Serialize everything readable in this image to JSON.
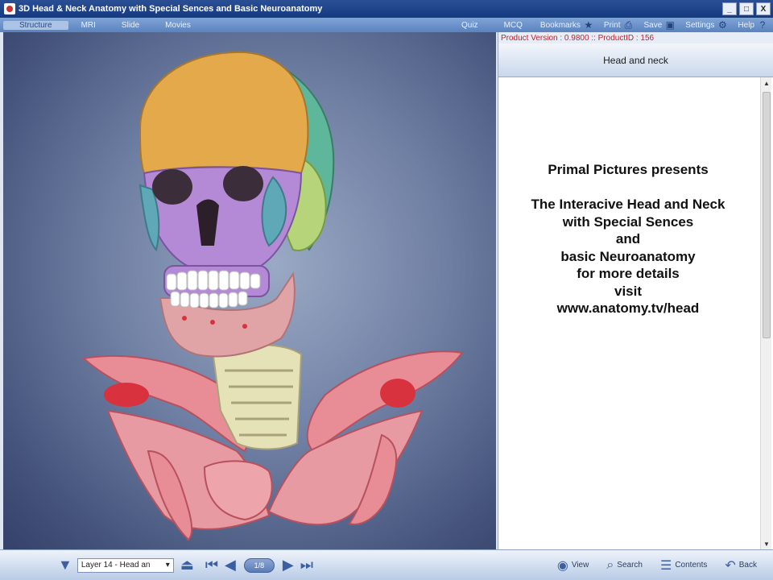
{
  "window": {
    "title": "3D Head & Neck Anatomy with Special Sences and Basic Neuroanatomy",
    "minimize": "_",
    "restore": "□",
    "close": "X"
  },
  "menu": {
    "items": [
      "Structure",
      "MRI",
      "Slide",
      "Movies",
      "Quiz",
      "MCQ"
    ],
    "tools": [
      {
        "label": "Bookmarks",
        "icon": "star-icon"
      },
      {
        "label": "Print",
        "icon": "printer-icon"
      },
      {
        "label": "Save",
        "icon": "disk-icon"
      },
      {
        "label": "Settings",
        "icon": "gear-icon"
      },
      {
        "label": "Help",
        "icon": "help-icon"
      }
    ]
  },
  "panel": {
    "version_text": "Product Version : 0.9800 :: ProductID : 156",
    "section_title": "Head and neck",
    "content_lines": [
      "Primal Pictures presents",
      "",
      "The Interacive Head and Neck",
      "with Special Sences",
      "and",
      "basic Neuroanatomy",
      "for more details",
      "visit",
      "www.anatomy.tv/head"
    ]
  },
  "bottom": {
    "layer_value": "Layer 14 - Head an",
    "counter": "1/8",
    "tools": [
      {
        "label": "View",
        "icon": "eye-icon"
      },
      {
        "label": "Search",
        "icon": "search-icon"
      },
      {
        "label": "Contents",
        "icon": "contents-icon"
      },
      {
        "label": "Back",
        "icon": "back-icon"
      }
    ]
  },
  "colors": {
    "skull_top": "#e3a94a",
    "skull_side": "#5eb79a",
    "face_bones": "#b489d6",
    "jaw": "#e0a3a6",
    "shoulder": "#e88c95",
    "vertebrae": "#e6e2b8"
  }
}
